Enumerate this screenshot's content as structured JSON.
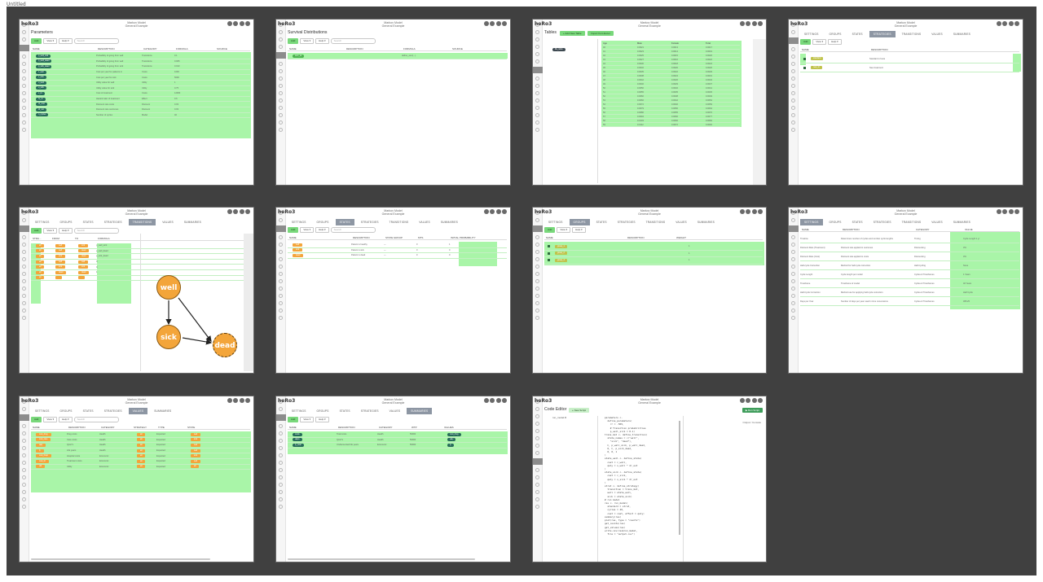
{
  "page": {
    "top_note": "Untitled"
  },
  "app": {
    "logo": "heRo3",
    "model_name": "Markov Model",
    "model_sub": "General Example"
  },
  "shots": [
    {
      "key": "parameters",
      "title": "Parameters",
      "toolbar": [
        "Add",
        "View ▾",
        "Help ▾",
        "Search"
      ],
      "columns": [
        "NAME",
        "DESCRIPTION",
        "CATEGORY",
        "FORMULA",
        "SOURCE"
      ],
      "rows": [
        [
          "p_well_sick",
          "Probability of going from well",
          "Transitions",
          "0.1"
        ],
        [
          "p_well_dead",
          "Probability of going from well",
          "Transitions",
          "0.005"
        ],
        [
          "p_sick_dead",
          "Probability of going from sick",
          "Transitions",
          "0.013"
        ],
        [
          "c_well",
          "Cost per year for patients in",
          "Costs",
          "1000"
        ],
        [
          "c_sick",
          "Cost per year for sick",
          "Costs",
          "5000"
        ],
        [
          "u_well",
          "Utility value for well",
          "Utility",
          "1"
        ],
        [
          "u_sick",
          "Utility value for sick",
          "Utility",
          "0.75"
        ],
        [
          "c_trt",
          "Cost of treatment",
          "Costs",
          "12000"
        ],
        [
          "hr_trt",
          "Hazard ratio of treatment",
          "Effect",
          "0.6"
        ],
        [
          "dr_cost",
          "Discount rate costs",
          "Discount",
          "0.03"
        ],
        [
          "dr_out",
          "Discount rate outcomes",
          "Discount",
          "0.03"
        ],
        [
          "n_cycles",
          "Number of cycles",
          "Model",
          "40"
        ]
      ]
    },
    {
      "key": "survival",
      "title": "Survival Distributions",
      "toolbar": [
        "Add",
        "View ▾",
        "Help ▾",
        "Search"
      ],
      "columns": [
        "NAME",
        "DESCRIPTION",
        "FORMULA",
        "SOURCE"
      ],
      "rows": [
        [
          "surv_os",
          "",
          "define_surv(...)",
          ""
        ]
      ]
    },
    {
      "key": "tables",
      "title": "Tables",
      "buttons": [
        "+ Add New Table",
        "Import from Excel"
      ],
      "table_name": "life_table",
      "columns": [
        "Age",
        "Male",
        "Female",
        "Total"
      ],
      "rows": [
        [
          "40",
          "0.0021",
          "0.0013",
          "0.0017"
        ],
        [
          "41",
          "0.0023",
          "0.0014",
          "0.0019"
        ],
        [
          "42",
          "0.0025",
          "0.0015",
          "0.0020"
        ],
        [
          "43",
          "0.0027",
          "0.0016",
          "0.0022"
        ],
        [
          "44",
          "0.0030",
          "0.0018",
          "0.0024"
        ],
        [
          "45",
          "0.0032",
          "0.0020",
          "0.0026"
        ],
        [
          "46",
          "0.0035",
          "0.0022",
          "0.0029"
        ],
        [
          "47",
          "0.0038",
          "0.0024",
          "0.0031"
        ],
        [
          "48",
          "0.0042",
          "0.0026",
          "0.0034"
        ],
        [
          "49",
          "0.0046",
          "0.0029",
          "0.0037"
        ],
        [
          "50",
          "0.0050",
          "0.0032",
          "0.0041"
        ],
        [
          "51",
          "0.0055",
          "0.0035",
          "0.0045"
        ],
        [
          "52",
          "0.0060",
          "0.0038",
          "0.0049"
        ],
        [
          "53",
          "0.0066",
          "0.0042",
          "0.0054"
        ],
        [
          "54",
          "0.0072",
          "0.0046",
          "0.0059"
        ],
        [
          "55",
          "0.0079",
          "0.0050",
          "0.0064"
        ],
        [
          "56",
          "0.0086",
          "0.0055",
          "0.0070"
        ],
        [
          "57",
          "0.0094",
          "0.0060",
          "0.0077"
        ],
        [
          "58",
          "0.0103",
          "0.0066",
          "0.0084"
        ],
        [
          "59",
          "0.0112",
          "0.0072",
          "0.0092"
        ]
      ]
    },
    {
      "key": "strategies",
      "tabs": [
        "SETTINGS",
        "GROUPS",
        "STATES",
        "STRATEGIES",
        "TRANSITIONS",
        "VALUES",
        "SUMMARIES"
      ],
      "active_tab": 3,
      "toolbar": [
        "Add",
        "View ▾",
        "Help ▾"
      ],
      "columns": [
        "NAME",
        "DESCRIPTION"
      ],
      "rows": [
        [
          "standard",
          "Standard of care"
        ],
        [
          "new_trt",
          "New treatment"
        ]
      ]
    },
    {
      "key": "transitions",
      "tabs": [
        "SETTINGS",
        "GROUPS",
        "STATES",
        "STRATEGIES",
        "TRANSITIONS",
        "VALUES",
        "SUMMARIES"
      ],
      "active_tab": 4,
      "toolbar": [
        "Add",
        "View ▾",
        "Help ▾",
        "Search"
      ],
      "columns": [
        "STRA...",
        "FROM",
        "TO",
        "FORMULA"
      ],
      "rows": [
        [
          "all",
          "well",
          "sick",
          "p_well_sick"
        ],
        [
          "all",
          "well",
          "dead",
          "p_well_dead"
        ],
        [
          "all",
          "sick",
          "dead",
          "p_sick_dead"
        ],
        [
          "all",
          "well",
          "well",
          "C"
        ],
        [
          "all",
          "sick",
          "sick",
          "C"
        ],
        [
          "all",
          "dead",
          "dead",
          "1"
        ],
        [
          "all",
          "",
          "",
          ""
        ]
      ],
      "nodes": {
        "well": "well",
        "sick": "sick",
        "dead": "dead"
      }
    },
    {
      "key": "states",
      "tabs": [
        "SETTINGS",
        "GROUPS",
        "STATES",
        "STRATEGIES",
        "TRANSITIONS",
        "VALUES",
        "SUMMARIES"
      ],
      "active_tab": 2,
      "toolbar": [
        "Add",
        "View ▾",
        "Help ▾",
        "Search"
      ],
      "columns": [
        "NAME",
        "DESCRIPTION",
        "STATE GROUP",
        "MTS",
        "INITIAL PROBABILITY"
      ],
      "rows": [
        [
          "well",
          "Patient is healthy",
          "—",
          "0",
          "1"
        ],
        [
          "sick",
          "Patient is sick",
          "—",
          "0",
          "0"
        ],
        [
          "dead",
          "Patient is dead",
          "—",
          "0",
          "0"
        ]
      ]
    },
    {
      "key": "groups",
      "tabs": [
        "SETTINGS",
        "GROUPS",
        "STATES",
        "STRATEGIES",
        "TRANSITIONS",
        "VALUES",
        "SUMMARIES"
      ],
      "active_tab": 1,
      "toolbar": [
        "Add",
        "View ▾",
        "Help ▾"
      ],
      "columns": [
        "NAME",
        "DESCRIPTION",
        "WEIGHT"
      ],
      "rows": [
        [
          "group_1",
          "",
          "1"
        ],
        [
          "group_2",
          "",
          "1"
        ],
        [
          "group_3",
          "",
          "1"
        ]
      ]
    },
    {
      "key": "settings",
      "tabs": [
        "SETTINGS",
        "GROUPS",
        "STATES",
        "STRATEGIES",
        "TRANSITIONS",
        "VALUES",
        "SUMMARIES"
      ],
      "active_tab": 0,
      "columns": [
        "NAME",
        "DESCRIPTION",
        "CATEGORY",
        "VALUE"
      ],
      "rows": [
        [
          "Timeline",
          "Determines number of cycles and number cycle lengths",
          "Timing",
          "Cycle Length 1 yr"
        ],
        [
          "Discount Rate (Treatment)",
          "Discount rate applied to outcomes",
          "Discounting",
          "3%"
        ],
        [
          "Discount Rate (Cost)",
          "Discount rate applied to costs",
          "Discounting",
          "3%"
        ],
        [
          "Half-cycle Correction",
          "Method for half-cycle correction",
          "Half-Cycling",
          "None"
        ],
        [
          "Cycle Length",
          "Cycle length per model",
          "Cycles & Timeframes",
          "1 Years"
        ],
        [
          "Timeframe",
          "Timeframe of model",
          "Cycles & Timeframes",
          "40 Years"
        ],
        [
          "Half-Cycle Correction",
          "Method use for applying half-cycle correction",
          "Cycles & Timeframes",
          "Half Cycle"
        ],
        [
          "Days per Year",
          "Number of days per year used in time conversions",
          "Cycles & Timeframes",
          "365.25"
        ]
      ]
    },
    {
      "key": "values",
      "tabs": [
        "SETTINGS",
        "GROUPS",
        "STATES",
        "STRATEGIES",
        "VALUES",
        "SUMMARIES"
      ],
      "active_tab": 4,
      "toolbar": [
        "Add",
        "View ▾",
        "Help ▾",
        "Search"
      ],
      "columns": [
        "NAME",
        "DESCRIPTION",
        "CATEGORY",
        "STRATEGY",
        "TYPE",
        "STATE"
      ],
      "rows": [
        [
          "cost_drug",
          "Drug costs",
          "Health",
          "all",
          "Expected",
          "well"
        ],
        [
          "cost_care",
          "Care costs",
          "Health",
          "all",
          "Expected",
          "sick"
        ],
        [
          "qaly",
          "QALYs",
          "Health",
          "all",
          "Expected",
          "well"
        ],
        [
          "ly",
          "Life years",
          "Health",
          "all",
          "Expected",
          "well"
        ],
        [
          "cost_hosp",
          "Hospital costs",
          "Economic",
          "all",
          "Expected",
          "sick"
        ],
        [
          "cost_trt",
          "Treatment costs",
          "Economic",
          "all",
          "Expected",
          "well"
        ],
        [
          "util",
          "Utility",
          "Economic",
          "all",
          "Expected",
          "all"
        ]
      ]
    },
    {
      "key": "summaries",
      "tabs": [
        "SETTINGS",
        "GROUPS",
        "STATES",
        "STRATEGIES",
        "VALUES",
        "SUMMARIES"
      ],
      "active_tab": 5,
      "toolbar": [
        "Add",
        "View ▾",
        "Help ▾"
      ],
      "columns": [
        "NAME",
        "DESCRIPTION",
        "CATEGORY",
        "WTP",
        "VALUES"
      ],
      "rows": [
        [
          "costs",
          "Total costs",
          "Health",
          "50000",
          "cost_drug"
        ],
        [
          "qalys",
          "QALYs",
          "Health",
          "50000",
          "qaly"
        ],
        [
          "ly_total",
          "Undiscounted life years",
          "Economic",
          "50000",
          "ly"
        ]
      ]
    },
    {
      "key": "code",
      "title": "Code Editor",
      "new_button": "+ New Script",
      "run_button": "▶ Run Script",
      "file_name": "run_model.R",
      "right_label": "Output / Console",
      "lines": [
        "parameters <-",
        "  define_parameters(",
        "    rr = .509,",
        "    # Transition probabilities",
        "    p_well_sick = 0.1)",
        "",
        "trans_mat <- define_transition(",
        "  state_names = c(\"well\",",
        "    \"sick\", \"dead\"),",
        "  C, p_well_sick, p_well_dead,",
        "  0, C, p_sick_dead,",
        "  0, 0, 1",
        ")",
        "",
        "state_well <- define_state(",
        "  cost = c_well,",
        "  qaly = u_well * dr_out",
        ")",
        "",
        "state_sick <- define_state(",
        "  cost = c_sick,",
        "  qaly = u_sick * dr_out",
        ")",
        "",
        "strat <- define_strategy(",
        "  transition = trans_mat,",
        "  well = state_well,",
        "  sick = state_sick)",
        "",
        "# run model",
        "res <- run_model(",
        "  standard = strat,",
        "  cycles = 40,",
        "  cost = cost, effect = qaly)",
        "",
        "summary(res)",
        "plot(res, type = \"counts\")",
        "",
        "get_counts(res)",
        "get_values(res)",
        "",
        "write.csv(res$run_model,",
        "  file = \"output.csv\")"
      ]
    }
  ],
  "colors": {
    "background": "#404040",
    "highlight": "#a9f5a8",
    "state_node": "#f3a53a",
    "param_pill": "#256b59",
    "active_tab": "#8d96a3"
  },
  "icons": {
    "toolbar_right": [
      "settings-icon",
      "help-icon",
      "info-icon",
      "user-icon"
    ]
  }
}
